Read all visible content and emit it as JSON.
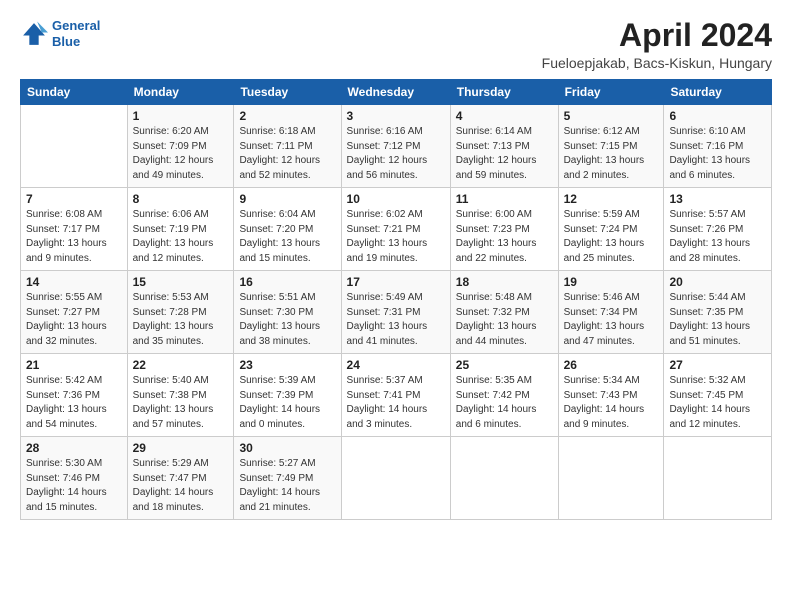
{
  "header": {
    "logo_line1": "General",
    "logo_line2": "Blue",
    "title": "April 2024",
    "location": "Fueloepjakab, Bacs-Kiskun, Hungary"
  },
  "weekdays": [
    "Sunday",
    "Monday",
    "Tuesday",
    "Wednesday",
    "Thursday",
    "Friday",
    "Saturday"
  ],
  "weeks": [
    [
      {
        "day": "",
        "info": ""
      },
      {
        "day": "1",
        "info": "Sunrise: 6:20 AM\nSunset: 7:09 PM\nDaylight: 12 hours\nand 49 minutes."
      },
      {
        "day": "2",
        "info": "Sunrise: 6:18 AM\nSunset: 7:11 PM\nDaylight: 12 hours\nand 52 minutes."
      },
      {
        "day": "3",
        "info": "Sunrise: 6:16 AM\nSunset: 7:12 PM\nDaylight: 12 hours\nand 56 minutes."
      },
      {
        "day": "4",
        "info": "Sunrise: 6:14 AM\nSunset: 7:13 PM\nDaylight: 12 hours\nand 59 minutes."
      },
      {
        "day": "5",
        "info": "Sunrise: 6:12 AM\nSunset: 7:15 PM\nDaylight: 13 hours\nand 2 minutes."
      },
      {
        "day": "6",
        "info": "Sunrise: 6:10 AM\nSunset: 7:16 PM\nDaylight: 13 hours\nand 6 minutes."
      }
    ],
    [
      {
        "day": "7",
        "info": "Sunrise: 6:08 AM\nSunset: 7:17 PM\nDaylight: 13 hours\nand 9 minutes."
      },
      {
        "day": "8",
        "info": "Sunrise: 6:06 AM\nSunset: 7:19 PM\nDaylight: 13 hours\nand 12 minutes."
      },
      {
        "day": "9",
        "info": "Sunrise: 6:04 AM\nSunset: 7:20 PM\nDaylight: 13 hours\nand 15 minutes."
      },
      {
        "day": "10",
        "info": "Sunrise: 6:02 AM\nSunset: 7:21 PM\nDaylight: 13 hours\nand 19 minutes."
      },
      {
        "day": "11",
        "info": "Sunrise: 6:00 AM\nSunset: 7:23 PM\nDaylight: 13 hours\nand 22 minutes."
      },
      {
        "day": "12",
        "info": "Sunrise: 5:59 AM\nSunset: 7:24 PM\nDaylight: 13 hours\nand 25 minutes."
      },
      {
        "day": "13",
        "info": "Sunrise: 5:57 AM\nSunset: 7:26 PM\nDaylight: 13 hours\nand 28 minutes."
      }
    ],
    [
      {
        "day": "14",
        "info": "Sunrise: 5:55 AM\nSunset: 7:27 PM\nDaylight: 13 hours\nand 32 minutes."
      },
      {
        "day": "15",
        "info": "Sunrise: 5:53 AM\nSunset: 7:28 PM\nDaylight: 13 hours\nand 35 minutes."
      },
      {
        "day": "16",
        "info": "Sunrise: 5:51 AM\nSunset: 7:30 PM\nDaylight: 13 hours\nand 38 minutes."
      },
      {
        "day": "17",
        "info": "Sunrise: 5:49 AM\nSunset: 7:31 PM\nDaylight: 13 hours\nand 41 minutes."
      },
      {
        "day": "18",
        "info": "Sunrise: 5:48 AM\nSunset: 7:32 PM\nDaylight: 13 hours\nand 44 minutes."
      },
      {
        "day": "19",
        "info": "Sunrise: 5:46 AM\nSunset: 7:34 PM\nDaylight: 13 hours\nand 47 minutes."
      },
      {
        "day": "20",
        "info": "Sunrise: 5:44 AM\nSunset: 7:35 PM\nDaylight: 13 hours\nand 51 minutes."
      }
    ],
    [
      {
        "day": "21",
        "info": "Sunrise: 5:42 AM\nSunset: 7:36 PM\nDaylight: 13 hours\nand 54 minutes."
      },
      {
        "day": "22",
        "info": "Sunrise: 5:40 AM\nSunset: 7:38 PM\nDaylight: 13 hours\nand 57 minutes."
      },
      {
        "day": "23",
        "info": "Sunrise: 5:39 AM\nSunset: 7:39 PM\nDaylight: 14 hours\nand 0 minutes."
      },
      {
        "day": "24",
        "info": "Sunrise: 5:37 AM\nSunset: 7:41 PM\nDaylight: 14 hours\nand 3 minutes."
      },
      {
        "day": "25",
        "info": "Sunrise: 5:35 AM\nSunset: 7:42 PM\nDaylight: 14 hours\nand 6 minutes."
      },
      {
        "day": "26",
        "info": "Sunrise: 5:34 AM\nSunset: 7:43 PM\nDaylight: 14 hours\nand 9 minutes."
      },
      {
        "day": "27",
        "info": "Sunrise: 5:32 AM\nSunset: 7:45 PM\nDaylight: 14 hours\nand 12 minutes."
      }
    ],
    [
      {
        "day": "28",
        "info": "Sunrise: 5:30 AM\nSunset: 7:46 PM\nDaylight: 14 hours\nand 15 minutes."
      },
      {
        "day": "29",
        "info": "Sunrise: 5:29 AM\nSunset: 7:47 PM\nDaylight: 14 hours\nand 18 minutes."
      },
      {
        "day": "30",
        "info": "Sunrise: 5:27 AM\nSunset: 7:49 PM\nDaylight: 14 hours\nand 21 minutes."
      },
      {
        "day": "",
        "info": ""
      },
      {
        "day": "",
        "info": ""
      },
      {
        "day": "",
        "info": ""
      },
      {
        "day": "",
        "info": ""
      }
    ]
  ]
}
